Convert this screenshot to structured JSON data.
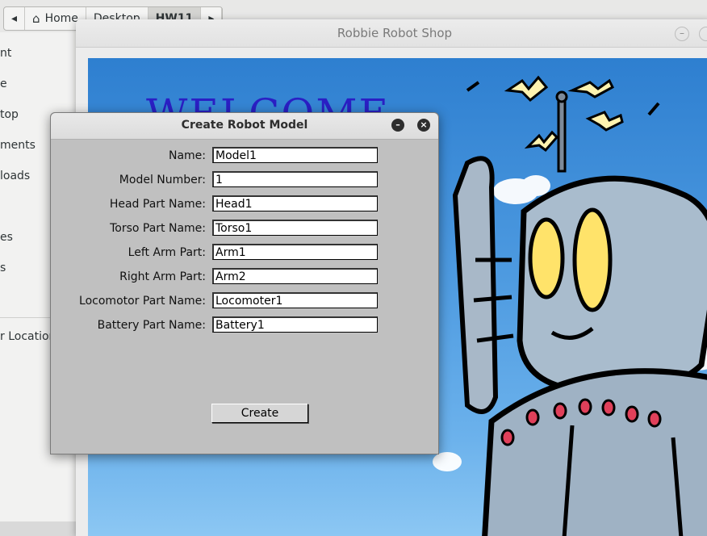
{
  "file_manager": {
    "path_buttons": [
      "Home",
      "Desktop",
      "HW11"
    ],
    "sidebar_items": [
      "nt",
      "e",
      "top",
      "ments",
      "loads",
      "",
      "es",
      "s",
      "r Locations"
    ]
  },
  "main_window": {
    "title": "Robbie Robot Shop",
    "welcome_text": "WELCOME"
  },
  "dialog": {
    "title": "Create Robot Model",
    "fields": [
      {
        "label": "Name:",
        "value": "Model1"
      },
      {
        "label": "Model Number:",
        "value": "1"
      },
      {
        "label": "Head Part Name:",
        "value": "Head1"
      },
      {
        "label": "Torso Part Name:",
        "value": "Torso1"
      },
      {
        "label": "Left Arm Part:",
        "value": "Arm1"
      },
      {
        "label": "Right Arm Part:",
        "value": "Arm2"
      },
      {
        "label": "Locomotor Part Name:",
        "value": "Locomoter1"
      },
      {
        "label": "Battery Part Name:",
        "value": "Battery1"
      }
    ],
    "create_label": "Create"
  }
}
